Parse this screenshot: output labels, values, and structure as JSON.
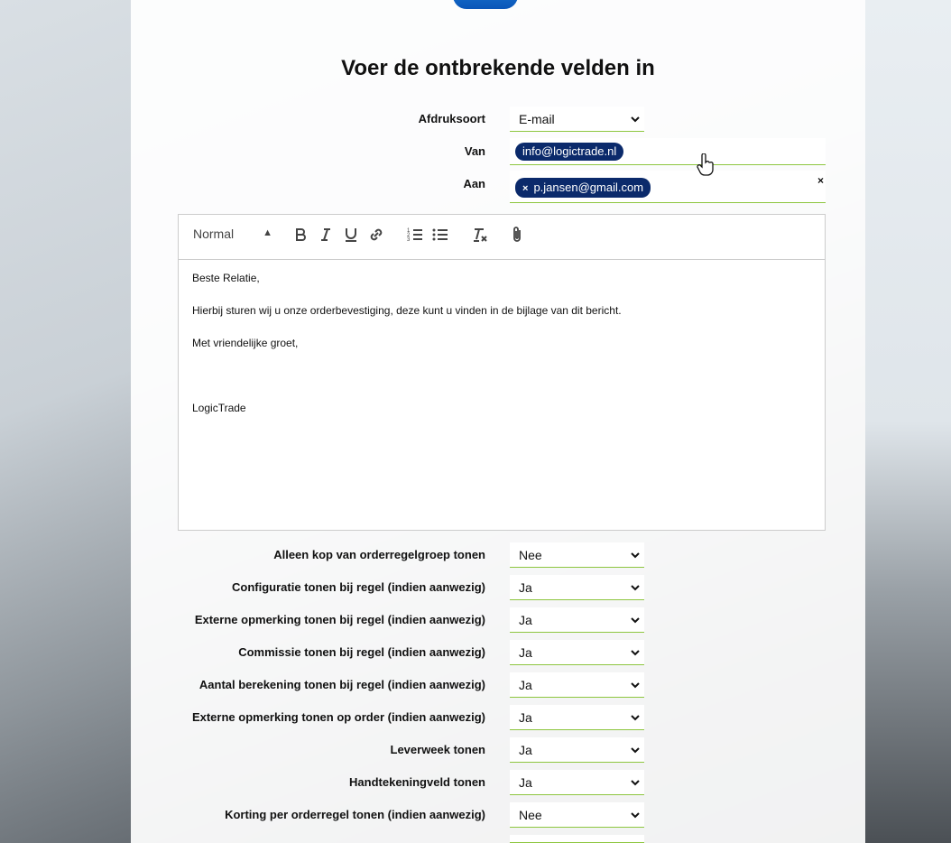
{
  "page": {
    "title": "Voer de ontbrekende velden in"
  },
  "header_fields": {
    "afdruksoort": {
      "label": "Afdruksoort",
      "value": "E-mail"
    },
    "van": {
      "label": "Van",
      "chip": "info@logictrade.nl"
    },
    "aan": {
      "label": "Aan",
      "chip_remove": "×",
      "chip": "p.jansen@gmail.com",
      "clear": "×"
    }
  },
  "editor": {
    "toolbar": {
      "format_value": "Normal",
      "buttons": [
        "bold-icon",
        "italic-icon",
        "underline-icon",
        "link-icon",
        "ordered-list-icon",
        "bullet-list-icon",
        "clear-format-icon",
        "attachment-icon"
      ]
    },
    "body": {
      "greeting": "Beste Relatie,",
      "line1": "Hierbij sturen wij u onze orderbevestiging, deze kunt u vinden in de bijlage van dit bericht.",
      "closing": "Met vriendelijke groet,",
      "signature": "LogicTrade"
    }
  },
  "options": [
    {
      "label": "Alleen kop van orderregelgroep tonen",
      "value": "Nee"
    },
    {
      "label": "Configuratie tonen bij regel (indien aanwezig)",
      "value": "Ja"
    },
    {
      "label": "Externe opmerking tonen bij regel (indien aanwezig)",
      "value": "Ja"
    },
    {
      "label": "Commissie tonen bij regel (indien aanwezig)",
      "value": "Ja"
    },
    {
      "label": "Aantal berekening tonen bij regel (indien aanwezig)",
      "value": "Ja"
    },
    {
      "label": "Externe opmerking tonen op order (indien aanwezig)",
      "value": "Ja"
    },
    {
      "label": "Leverweek tonen",
      "value": "Ja"
    },
    {
      "label": "Handtekeningveld tonen",
      "value": "Ja"
    },
    {
      "label": "Korting per orderregel tonen (indien aanwezig)",
      "value": "Nee"
    }
  ],
  "colors": {
    "chip": "#0b2a6b",
    "underline": "#8dc63f",
    "accent": "#1c7bd6"
  }
}
